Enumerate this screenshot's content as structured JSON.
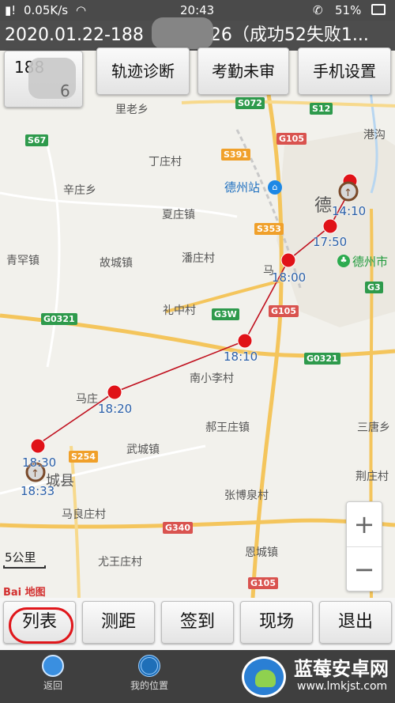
{
  "status_bar": {
    "network_speed": "0.05K/s",
    "time": "20:43",
    "battery": "51%"
  },
  "title": {
    "text_left": "2020.01.22-188",
    "text_right": "26（成功52失败1..."
  },
  "top_buttons": {
    "user_prefix": "188",
    "user_tail": "6",
    "track_diagnosis": "轨迹诊断",
    "attendance_unreviewed": "考勤未审",
    "phone_settings": "手机设置"
  },
  "map": {
    "places": [
      "里老乡",
      "丁庄村",
      "辛庄乡",
      "夏庄镇",
      "青罕镇",
      "故城镇",
      "潘庄村",
      "礼中村",
      "南小李村",
      "马庄",
      "郝王庄镇",
      "武城镇",
      "城县",
      "张博泉村",
      "马良庄村",
      "尤王庄村",
      "恩城镇",
      "三唐乡",
      "荆庄村",
      "港沟",
      "德",
      "马"
    ],
    "station": "德州站",
    "park": "德州市",
    "roads": [
      "S072",
      "S12",
      "S67",
      "S391",
      "G105",
      "S353",
      "G3W",
      "G105",
      "G0321",
      "G0321",
      "S254",
      "G340",
      "G105",
      "G3"
    ],
    "times": [
      "14:10",
      "17:50",
      "18:00",
      "18:10",
      "18:20",
      "18:30",
      "18:33"
    ],
    "scale": "5公里",
    "baidu_logo": "Bai 地图",
    "zoom_in": "+",
    "zoom_out": "−",
    "colors": {
      "track": "#c0101e",
      "marker": "#e01218",
      "station": "#1e6fbf",
      "park": "#1f9a3c"
    }
  },
  "actions": {
    "list": "列表",
    "measure": "测距",
    "checkin": "签到",
    "scene": "现场",
    "exit": "退出"
  },
  "nav": {
    "back": "返回",
    "my_location": "我的位置"
  },
  "watermark": {
    "title": "蓝莓安卓网",
    "url": "www.lmkjst.com"
  }
}
